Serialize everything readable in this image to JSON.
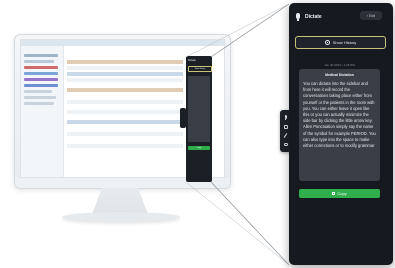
{
  "panel": {
    "title": "Dictate",
    "exit_label": "Exit",
    "show_history_label": "Show History",
    "timestamp": "Jun 30 2023 • 1:36 PM",
    "card": {
      "title": "Medical Dictation",
      "body": "You can dictate into the sidebar and from here it will record the conversations taking place either from yourself or the patients in the room with you. You can either leave it open like this or you can actually minimize the side bar by clicking the little arrow key. Allen Punctuation simply say the name of the symbol for example PERIOD. You can also type into the space to make either corrections or to modify grammar"
    },
    "copy_label": "Copy"
  },
  "mini_panel": {
    "title": "Dictate",
    "history_label": "Show History",
    "copy_label": "Copy"
  },
  "icons": [
    "microphone-icon",
    "clock-icon",
    "copy-icon",
    "checkbox-icon",
    "pen-icon",
    "link-icon"
  ],
  "colors": {
    "panel_bg": "#16191f",
    "card_bg": "#3a3f47",
    "copy_button": "#2fae4b",
    "history_border": "#c9c37a"
  }
}
